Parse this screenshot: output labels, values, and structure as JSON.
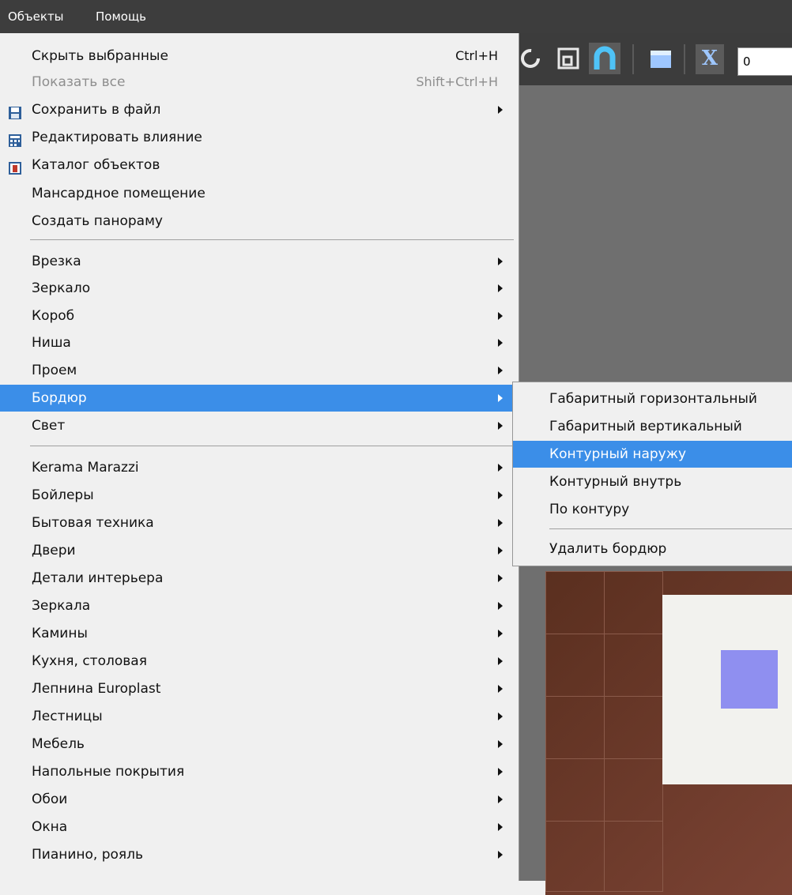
{
  "menubar": {
    "objects": "Объекты",
    "help": "Помощь"
  },
  "toolbar": {
    "x_label": "X",
    "x_value": "0"
  },
  "menu": {
    "hide_selected": "Скрыть выбранные",
    "hide_selected_shortcut": "Ctrl+H",
    "show_all": "Показать все",
    "show_all_shortcut": "Shift+Ctrl+H",
    "save_to_file": "Сохранить в файл",
    "edit_influence": "Редактировать влияние",
    "object_catalog": "Каталог объектов",
    "attic_room": "Мансардное помещение",
    "create_panorama": "Создать панораму",
    "inset": "Врезка",
    "mirror": "Зеркало",
    "box": "Короб",
    "niche": "Ниша",
    "opening": "Проем",
    "border": "Бордюр",
    "light": "Свет",
    "kerama": "Kerama Marazzi",
    "boilers": "Бойлеры",
    "appliances": "Бытовая техника",
    "doors": "Двери",
    "interior_details": "Детали интерьера",
    "mirrors": "Зеркала",
    "fireplaces": "Камины",
    "kitchen": "Кухня, столовая",
    "stucco": "Лепнина Europlast",
    "stairs": "Лестницы",
    "furniture": "Мебель",
    "floor_coverings": "Напольные покрытия",
    "wallpaper": "Обои",
    "windows": "Окна",
    "piano": "Пианино, рояль"
  },
  "submenu": {
    "gabarit_horizontal": "Габаритный горизонтальный",
    "gabarit_vertical": "Габаритный вертикальный",
    "contour_outside": "Контурный наружу",
    "contour_inside": "Контурный внутрь",
    "along_contour": "По контуру",
    "delete_border": "Удалить бордюр"
  },
  "colors": {
    "highlight": "#3b8ee8",
    "menubar": "#3d3d3d"
  }
}
